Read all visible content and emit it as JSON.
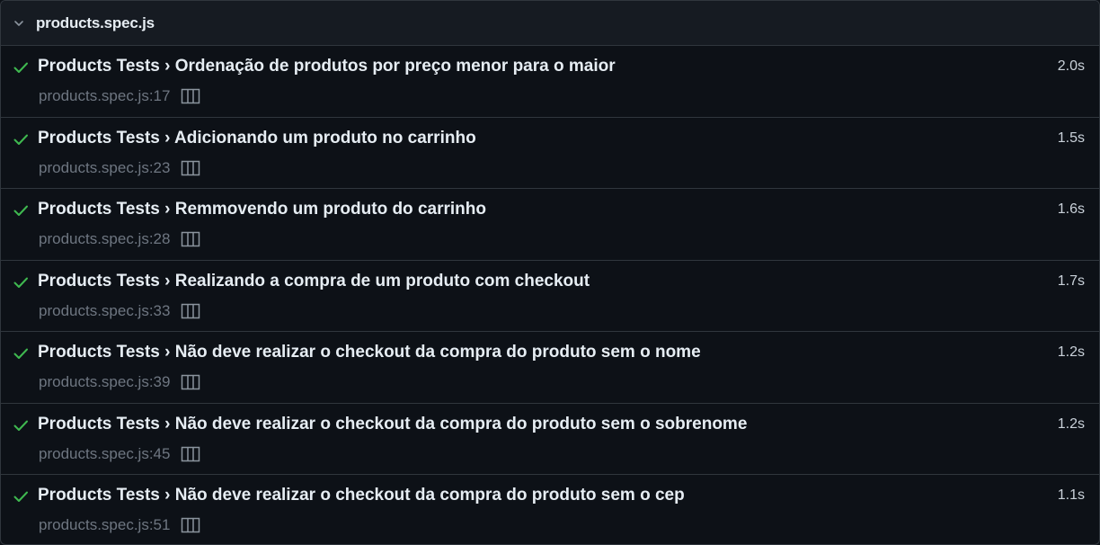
{
  "file": {
    "name": "products.spec.js",
    "expanded": true
  },
  "colors": {
    "background": "#0d1117",
    "header_bg": "#161b22",
    "border": "#30363d",
    "pass": "#3fb950",
    "muted": "#6e7681"
  },
  "tests": [
    {
      "status": "passed",
      "status_icon": "check-icon",
      "title": "Products Tests › Ordenação de produtos por preço menor para o maior",
      "duration": "2.0s",
      "location": "products.spec.js:17"
    },
    {
      "status": "passed",
      "status_icon": "check-icon",
      "title": "Products Tests › Adicionando um produto no carrinho",
      "duration": "1.5s",
      "location": "products.spec.js:23"
    },
    {
      "status": "passed",
      "status_icon": "check-icon",
      "title": "Products Tests › Remmovendo um produto do carrinho",
      "duration": "1.6s",
      "location": "products.spec.js:28"
    },
    {
      "status": "passed",
      "status_icon": "check-icon",
      "title": "Products Tests › Realizando a compra de um produto com checkout",
      "duration": "1.7s",
      "location": "products.spec.js:33"
    },
    {
      "status": "passed",
      "status_icon": "check-icon",
      "title": "Products Tests › Não deve realizar o checkout da compra do produto sem o nome",
      "duration": "1.2s",
      "location": "products.spec.js:39"
    },
    {
      "status": "passed",
      "status_icon": "check-icon",
      "title": "Products Tests › Não deve realizar o checkout da compra do produto sem o sobrenome",
      "duration": "1.2s",
      "location": "products.spec.js:45"
    },
    {
      "status": "passed",
      "status_icon": "check-icon",
      "title": "Products Tests › Não deve realizar o checkout da compra do produto sem o cep",
      "duration": "1.1s",
      "location": "products.spec.js:51"
    }
  ]
}
